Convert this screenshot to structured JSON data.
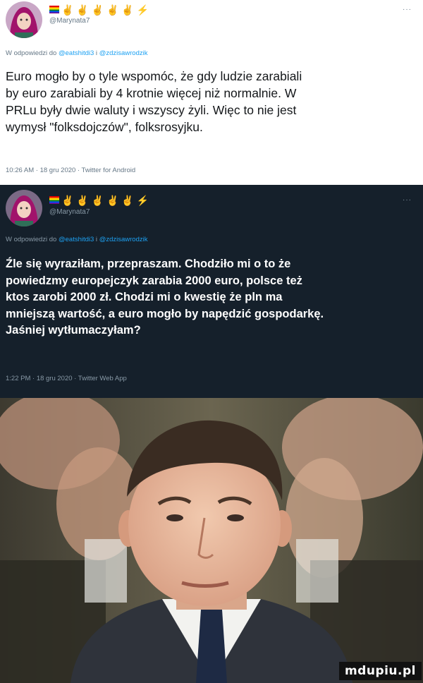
{
  "tweet_1": {
    "emojis": "✌ ✌ ✌ ✌ ✌ ⚡",
    "handle": "@Marynata7",
    "more": "···",
    "reply_prefix": "W odpowiedzi do ",
    "reply_user_1": "@eatshitdi3",
    "reply_sep": " i ",
    "reply_user_2": "@zdzisawrodzik",
    "text": "Euro mogło by o tyle wspomóc, że gdy ludzie zarabiali\nby euro zarabiali by 4 krotnie więcej niż normalnie. W\nPRLu były dwie waluty i wszyscy żyli. Więc to nie jest\nwymysł \"folksdojczów\", folksrosyjku.",
    "meta": "10:26 AM · 18 gru 2020 · Twitter for Android"
  },
  "tweet_2": {
    "emojis": "✌ ✌ ✌ ✌ ✌ ⚡",
    "handle": "@Marynata7",
    "more": "···",
    "reply_prefix": "W odpowiedzi do ",
    "reply_user_1": "@eatshitdi3",
    "reply_sep": " i ",
    "reply_user_2": "@zdzisawrodzik",
    "text": "Źle się wyraziłam, przepraszam. Chodziło mi o to że\npowiedzmy europejczyk zarabia 2000 euro, polsce też\nktos zarobi 2000 zł. Chodzi mi o kwestię że pln ma\nmniejszą wartość, a euro mogło by napędzić gospodarkę.\nJaśniej wytłumaczyłam?",
    "meta": "1:22 PM · 18 gru 2020 · Twitter Web App"
  },
  "watermark": "mdupiu.pl",
  "colors": {
    "mention": "#1da1f2",
    "dark_bg": "#15202b",
    "muted_light": "#657786",
    "muted_dark": "#8899a6"
  }
}
